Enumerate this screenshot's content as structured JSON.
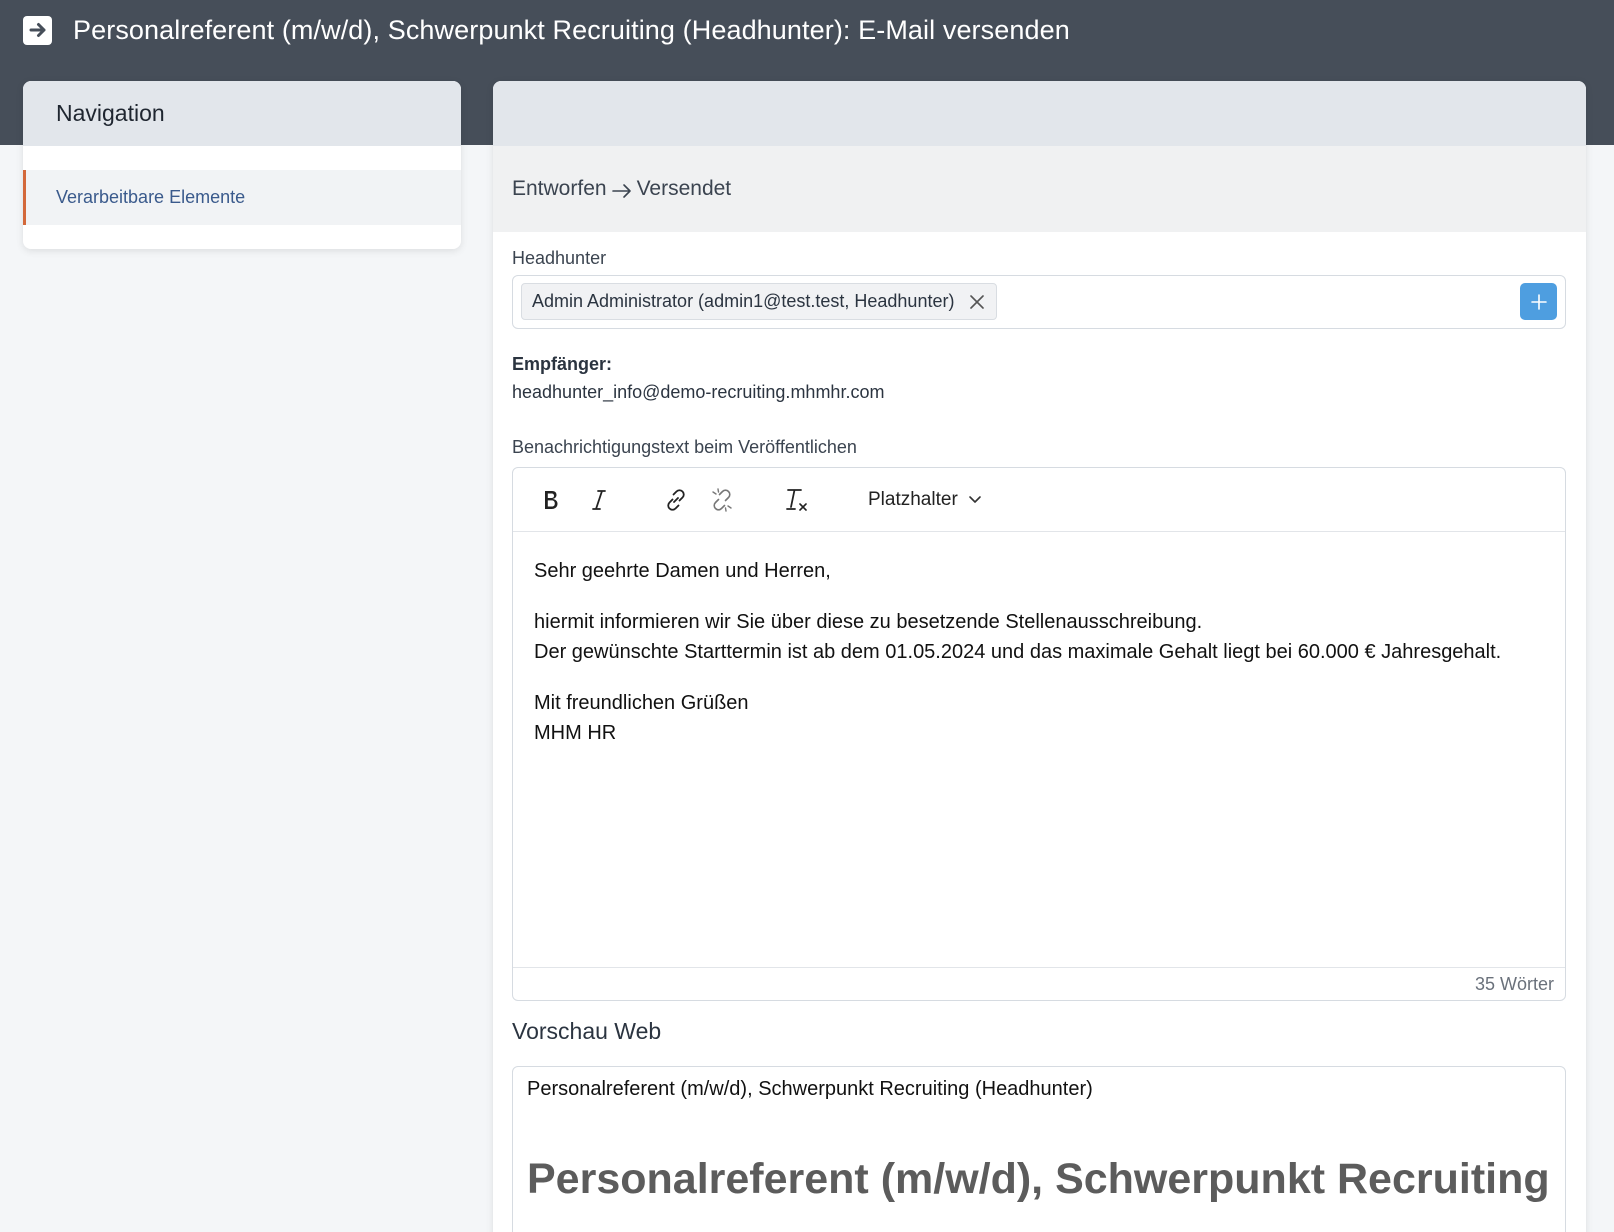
{
  "header": {
    "title": "Personalreferent (m/w/d), Schwerpunkt Recruiting (Headhunter): E-Mail versenden"
  },
  "navigation": {
    "title": "Navigation",
    "items": [
      {
        "label": "Verarbeitbare Elemente"
      }
    ]
  },
  "status": {
    "from": "Entworfen",
    "to": "Versendet"
  },
  "headhunter": {
    "label": "Headhunter",
    "selected": "Admin Administrator (admin1@test.test, Headhunter)"
  },
  "recipient": {
    "label": "Empfänger:",
    "value": "headhunter_info@demo-recruiting.mhmhr.com"
  },
  "editor": {
    "label": "Benachrichtigungstext beim Veröffentlichen",
    "placeholder_menu": "Platzhalter",
    "body": {
      "greeting": "Sehr geehrte Damen und Herren,",
      "line1": "hiermit informieren wir Sie über diese zu besetzende Stellenausschreibung.",
      "line2": "Der gewünschte Starttermin ist ab dem 01.05.2024 und das maximale Gehalt liegt bei 60.000 € Jahresgehalt.",
      "closing": "Mit freundlichen Grüßen",
      "signature": "MHM HR"
    },
    "word_count": "35 Wörter"
  },
  "preview": {
    "title": "Vorschau Web",
    "subject_line": "Personalreferent (m/w/d), Schwerpunkt Recruiting (Headhunter)",
    "heading": "Personalreferent (m/w/d), Schwerpunkt Recruiting"
  },
  "colors": {
    "topbar": "#464e59",
    "accent": "#d3683a",
    "link": "#3a5a8c",
    "primary_button": "#4e9ee0"
  }
}
